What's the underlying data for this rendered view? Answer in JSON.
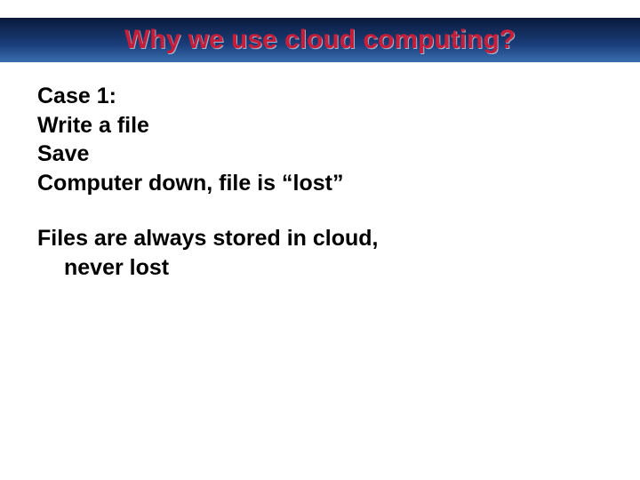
{
  "title": "Why we use cloud computing?",
  "case1": {
    "line1": "Case 1:",
    "line2": "Write a file",
    "line3": "Save",
    "line4": "Computer down, file is “lost”"
  },
  "statement": {
    "line1": "Files are always stored in cloud,",
    "line2": "never lost"
  }
}
